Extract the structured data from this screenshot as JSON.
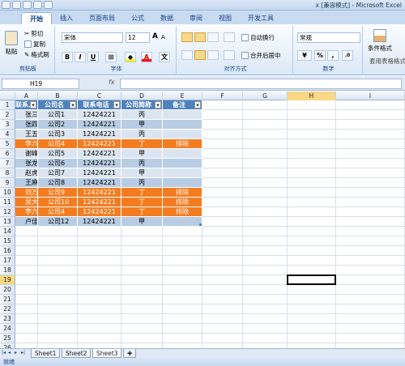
{
  "app": {
    "title": "x [兼容模式] - Microsoft Excel"
  },
  "tabs": [
    {
      "label": "开始"
    },
    {
      "label": "插入"
    },
    {
      "label": "页面布局"
    },
    {
      "label": "公式"
    },
    {
      "label": "数据"
    },
    {
      "label": "审阅"
    },
    {
      "label": "视图"
    },
    {
      "label": "开发工具"
    }
  ],
  "ribbon": {
    "clipboard": {
      "label": "剪贴板",
      "paste": "粘贴",
      "cut": "剪切",
      "copy": "复制",
      "format_painter": "格式刷"
    },
    "font": {
      "label": "字体",
      "name": "宋体",
      "size": "12",
      "bold": "B",
      "italic": "I",
      "underline": "U",
      "grow": "A",
      "shrink": "A"
    },
    "alignment": {
      "label": "对齐方式",
      "wrap": "自动换行",
      "merge": "合并后居中"
    },
    "number": {
      "label": "数字",
      "format": "常规",
      "percent": "%",
      "comma": ","
    },
    "styles": {
      "conditional": "条件格式",
      "table": "套用表格格式"
    }
  },
  "formula_bar": {
    "name_box": "H19",
    "fx": "fx",
    "value": ""
  },
  "columns": [
    "A",
    "B",
    "C",
    "D",
    "E",
    "F",
    "G",
    "H",
    "I"
  ],
  "selected_column": "H",
  "selected_row": "19",
  "rows": [
    "1",
    "2",
    "3",
    "4",
    "5",
    "6",
    "7",
    "8",
    "9",
    "10",
    "11",
    "12",
    "13",
    "14",
    "15",
    "16",
    "17",
    "18",
    "19",
    "20",
    "21",
    "22",
    "23",
    "24",
    "25",
    "26"
  ],
  "table": {
    "headers": [
      "联系人",
      "公司名",
      "联系电话",
      "公司简称",
      "备注"
    ],
    "records": [
      {
        "name": "张三",
        "company": "公司1",
        "phone": "12424221",
        "abbr": "丙",
        "note": "",
        "hl": false
      },
      {
        "name": "张四",
        "company": "公司2",
        "phone": "12424221",
        "abbr": "甲",
        "note": "",
        "hl": false
      },
      {
        "name": "王五",
        "company": "公司3",
        "phone": "12424221",
        "abbr": "丙",
        "note": "",
        "hl": false
      },
      {
        "name": "李六",
        "company": "公司4",
        "phone": "12424221",
        "abbr": "丁",
        "note": "排除",
        "hl": true
      },
      {
        "name": "谢峰",
        "company": "公司5",
        "phone": "12424221",
        "abbr": "甲",
        "note": "",
        "hl": false
      },
      {
        "name": "张龙",
        "company": "公司6",
        "phone": "12424221",
        "abbr": "丙",
        "note": "",
        "hl": false
      },
      {
        "name": "赵虎",
        "company": "公司7",
        "phone": "12424221",
        "abbr": "甲",
        "note": "",
        "hl": false
      },
      {
        "name": "王麻子",
        "company": "公司8",
        "phone": "12424221",
        "abbr": "丙",
        "note": "",
        "hl": false
      },
      {
        "name": "刘万福",
        "company": "公司9",
        "phone": "12424221",
        "abbr": "丁",
        "note": "排除",
        "hl": true
      },
      {
        "name": "吴大",
        "company": "公司10",
        "phone": "12424221",
        "abbr": "丁",
        "note": "排除",
        "hl": true
      },
      {
        "name": "李六",
        "company": "公司4",
        "phone": "12424221",
        "abbr": "丁",
        "note": "排除",
        "hl": true
      },
      {
        "name": "卢佳佳",
        "company": "公司12",
        "phone": "12424221",
        "abbr": "甲",
        "note": "",
        "hl": false
      }
    ]
  },
  "sheets": [
    {
      "label": "Sheet1"
    },
    {
      "label": "Sheet2"
    },
    {
      "label": "Sheet3"
    }
  ],
  "active_sheet": "Sheet3",
  "status": {
    "text": "就绪"
  },
  "colors": {
    "header_fill": "#4f81bd",
    "band_light": "#dbe5f1",
    "band_dark": "#b8cce4",
    "highlight": "#f47c20",
    "selection": "#f8d785"
  }
}
